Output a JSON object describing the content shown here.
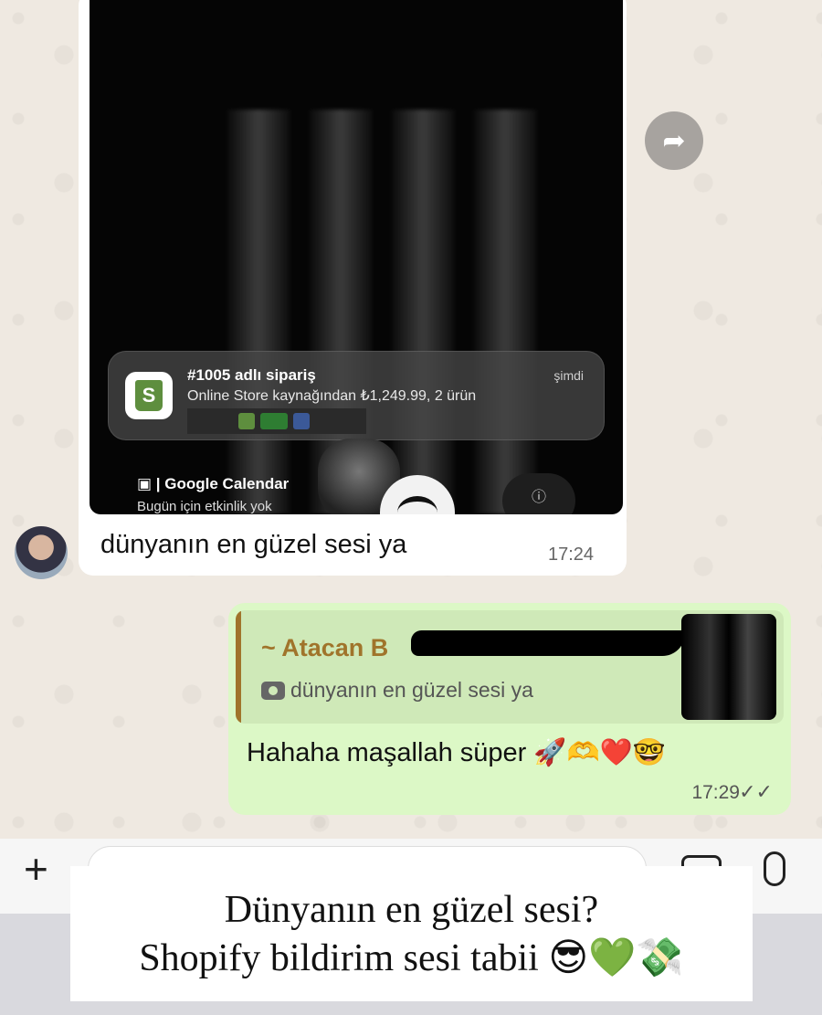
{
  "incoming": {
    "notification": {
      "title": "#1005 adlı sipariş",
      "body": "Online Store kaynağından ₺1,249.99, 2 ürün",
      "time": "şimdi"
    },
    "calendar": {
      "label": "Google Calendar",
      "sub": "Bugün için etkinlik yok"
    },
    "caption": "dünyanın en güzel sesi ya",
    "time": "17:24"
  },
  "outgoing": {
    "quote": {
      "sender": "~ Atacan B",
      "text": "dünyanın en güzel sesi ya"
    },
    "text": "Hahaha maşallah süper",
    "emojis": "🚀🫶❤️🤓",
    "time": "17:29",
    "ticks": "✓✓"
  },
  "overlay": {
    "line1": "Dünyanın en güzel sesi?",
    "line2": "Shopify bildirim sesi tabii",
    "line2_emojis": "😎💚💸"
  },
  "icons": {
    "forward": "forward-icon",
    "plus": "plus-icon",
    "camera": "camera-icon",
    "mic": "microphone-icon"
  }
}
